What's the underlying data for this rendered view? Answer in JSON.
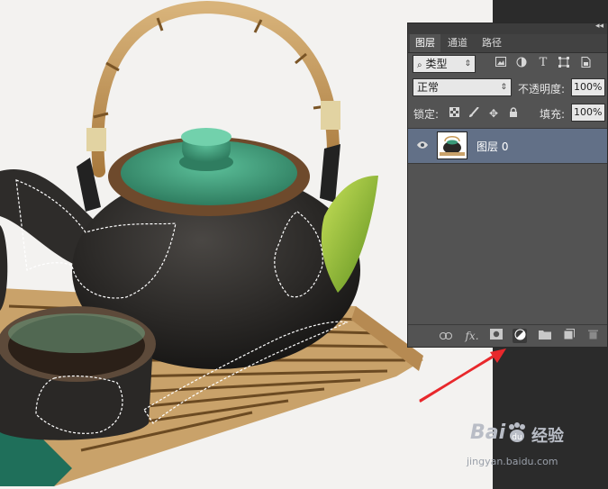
{
  "colors": {
    "panel_bg": "#535353",
    "selected_layer": "#627087",
    "annotation_arrow": "#e8282c",
    "tea_lid_green": "#3b9a78",
    "teapot_body": "#2a2826"
  },
  "panel": {
    "collapse_icon": "double-chevron-icon",
    "tabs": [
      {
        "label": "图层",
        "active": true
      },
      {
        "label": "通道",
        "active": false
      },
      {
        "label": "路径",
        "active": false
      }
    ],
    "filter": {
      "label": "类型",
      "icon": "search-icon",
      "tools": [
        "image-filter-icon",
        "adjustment-filter-icon",
        "text-filter-icon",
        "shape-filter-icon",
        "smart-object-filter-icon"
      ]
    },
    "blend_mode": "正常",
    "opacity_label": "不透明度:",
    "opacity_value": "100%",
    "lock_label": "锁定:",
    "lock_icons": [
      "lock-transparent-icon",
      "lock-paint-icon",
      "lock-move-icon",
      "lock-all-icon"
    ],
    "fill_label": "填充:",
    "fill_value": "100%",
    "layers": [
      {
        "name": "图层 0",
        "visible": true,
        "selected": true
      }
    ],
    "bottom_icons": [
      "link-icon",
      "fx-icon",
      "layer-mask-icon",
      "adjustment-layer-icon",
      "group-folder-icon",
      "new-layer-icon",
      "trash-icon"
    ],
    "fx_label": "fx."
  },
  "watermark": {
    "brand": "Bai",
    "brand_tail": "经验",
    "url": "jingyan.baidu.com"
  }
}
